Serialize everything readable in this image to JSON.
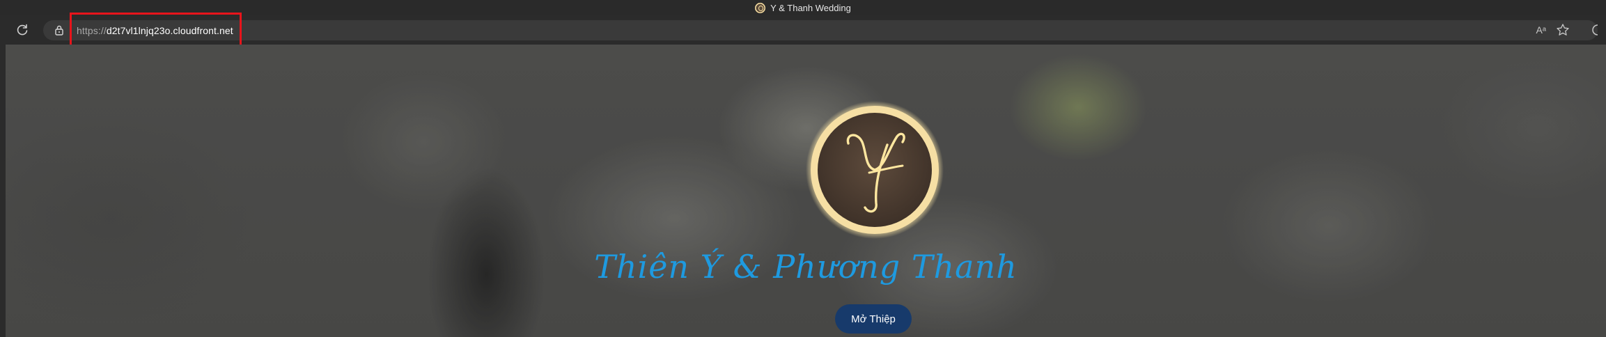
{
  "window": {
    "title": "Y & Thanh Wedding",
    "favicon_icon": "monogram-favicon-icon"
  },
  "toolbar": {
    "reload_icon": "reload-icon",
    "lock_icon": "lock-icon",
    "url_scheme": "https://",
    "url_host": "d2t7vl1lnjq23o.cloudfront.net",
    "read_aloud_label": "Aᵃ",
    "favorite_icon": "star-icon"
  },
  "page": {
    "monogram": "YT",
    "couple_name": "Thiên Ý & Phương Thanh",
    "open_button_label": "Mở Thiệp"
  },
  "colors": {
    "accent_blue": "#1e9ae0",
    "button_bg": "#173a6b",
    "highlight_red": "#e8141b",
    "monogram_gold": "#f5dca0"
  }
}
